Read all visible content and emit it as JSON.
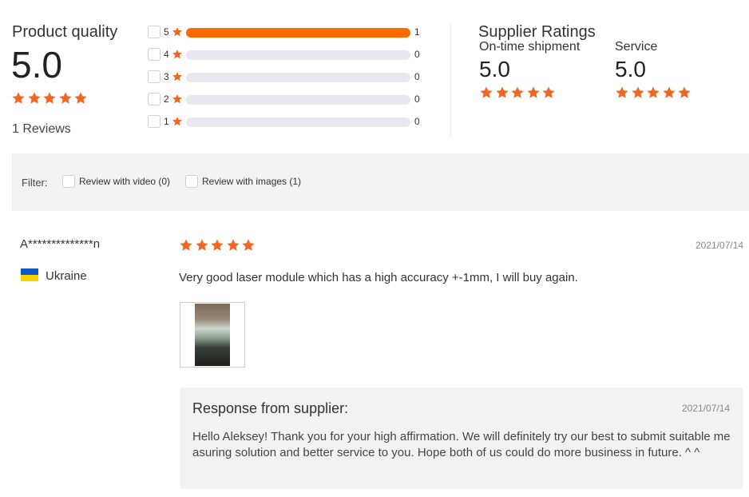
{
  "product_quality": {
    "title": "Product quality",
    "score": "5.0",
    "stars": 5,
    "reviews_label": "1 Reviews"
  },
  "distribution": [
    {
      "stars": "5",
      "count": "1",
      "fill_fraction": 1.0
    },
    {
      "stars": "4",
      "count": "0",
      "fill_fraction": 0
    },
    {
      "stars": "3",
      "count": "0",
      "fill_fraction": 0
    },
    {
      "stars": "2",
      "count": "0",
      "fill_fraction": 0
    },
    {
      "stars": "1",
      "count": "0",
      "fill_fraction": 0
    }
  ],
  "supplier_ratings": {
    "title": "Supplier Ratings",
    "shipment_label": "On-time shipment",
    "shipment_score": "5.0",
    "service_label": "Service",
    "service_score": "5.0"
  },
  "filter": {
    "label": "Filter:",
    "video_option": "Review with video (0)",
    "images_option": "Review with images (1)"
  },
  "review": {
    "reviewer": "A**************n",
    "country": "Ukraine",
    "stars": 5,
    "date": "2021/07/14",
    "text": "Very good laser module which has a high accuracy +-1mm, I will buy again."
  },
  "response": {
    "title": "Response from supplier:",
    "date": "2021/07/14",
    "text": "Hello Aleksey! Thank you for your high affirmation. We will definitely try our best to submit suitable measuring solution and better service to you. Hope both of us could do more business in future. ^ ^"
  },
  "colors": {
    "accent": "#ff6a00",
    "star": "#f26522",
    "track": "#e8e8ee",
    "panel": "#f2f2f2"
  },
  "icons": {
    "star": "star-icon",
    "flag": "ukraine-flag-icon"
  }
}
